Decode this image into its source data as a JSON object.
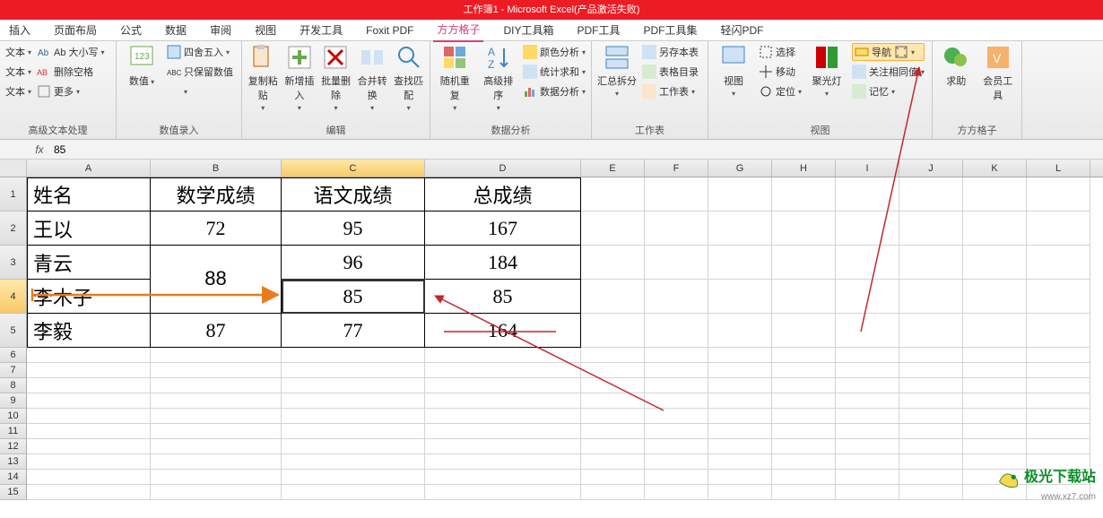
{
  "title": "工作簿1 - Microsoft Excel(产品激活失败)",
  "tabs": [
    "插入",
    "页面布局",
    "公式",
    "数据",
    "审阅",
    "视图",
    "开发工具",
    "Foxit PDF",
    "方方格子",
    "DIY工具箱",
    "PDF工具",
    "PDF工具集",
    "轻闪PDF"
  ],
  "active_tab": 8,
  "groups": {
    "g1": {
      "label": "高级文本处理",
      "items": {
        "a": "文本",
        "b": "文本",
        "c": "文本",
        "d": "Ab 大小写",
        "e": "删除空格",
        "f": "更多"
      }
    },
    "g2": {
      "label": "数值录入",
      "big": "数值",
      "items": {
        "a": "四舍五入",
        "b": "只保留数值",
        "c": ""
      }
    },
    "g3": {
      "label": "编辑",
      "big": [
        "复制粘贴",
        "新增插入",
        "批量删除",
        "合并转换",
        "查找匹配"
      ]
    },
    "g4": {
      "label": "数据分析",
      "big": [
        "随机重复",
        "高级排序"
      ],
      "items": {
        "a": "颜色分析",
        "b": "统计求和",
        "c": "数据分析"
      }
    },
    "g5": {
      "label": "工作表",
      "big": "汇总拆分",
      "items": {
        "a": "另存本表",
        "b": "表格目录",
        "c": "工作表"
      }
    },
    "g6": {
      "label": "视图",
      "big": [
        "视图",
        "聚光灯"
      ],
      "items": {
        "a": "选择",
        "b": "移动",
        "c": "定位",
        "d": "导航",
        "e": "关注相同值",
        "f": "记忆"
      }
    },
    "g7": {
      "label": "方方格子",
      "big": [
        "求助",
        "会员工具"
      ]
    }
  },
  "formula": {
    "fx": "fx",
    "value": "85"
  },
  "columns": [
    "A",
    "B",
    "C",
    "D",
    "E",
    "F",
    "G",
    "H",
    "I",
    "J",
    "K",
    "L"
  ],
  "row_nums": [
    "1",
    "2",
    "3",
    "4",
    "5",
    "6",
    "7",
    "8",
    "9",
    "10",
    "11",
    "12",
    "13",
    "14",
    "15"
  ],
  "data": {
    "header": {
      "A": "姓名",
      "B": "数学成绩",
      "C": "语文成绩",
      "D": "总成绩"
    },
    "r2": {
      "A": "王以",
      "B": "72",
      "C": "95",
      "D": "167"
    },
    "r3": {
      "A": "青云",
      "B": "",
      "C": "96",
      "D": "184"
    },
    "r4": {
      "A": "李木子",
      "B": "88",
      "C": "85",
      "D": "85"
    },
    "r5": {
      "A": "李毅",
      "B": "87",
      "C": "77",
      "D": "164"
    }
  },
  "active_cell": "C4",
  "watermark": {
    "line1": "极光下载站",
    "line2": "www.xz7.com"
  }
}
